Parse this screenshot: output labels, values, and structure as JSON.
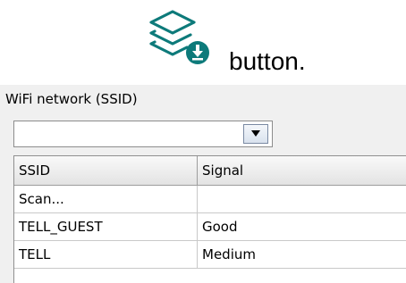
{
  "instruction": {
    "icon": "layers-download-icon",
    "caption": "button.",
    "icon_color": "#0d7a7a"
  },
  "wifi": {
    "label": "WiFi network (SSID)",
    "combo_value": "",
    "table": {
      "columns": [
        "SSID",
        "Signal"
      ],
      "rows": [
        {
          "ssid": "Scan...",
          "signal": ""
        },
        {
          "ssid": "TELL_GUEST",
          "signal": "Good"
        },
        {
          "ssid": "TELL",
          "signal": "Medium"
        }
      ]
    }
  }
}
